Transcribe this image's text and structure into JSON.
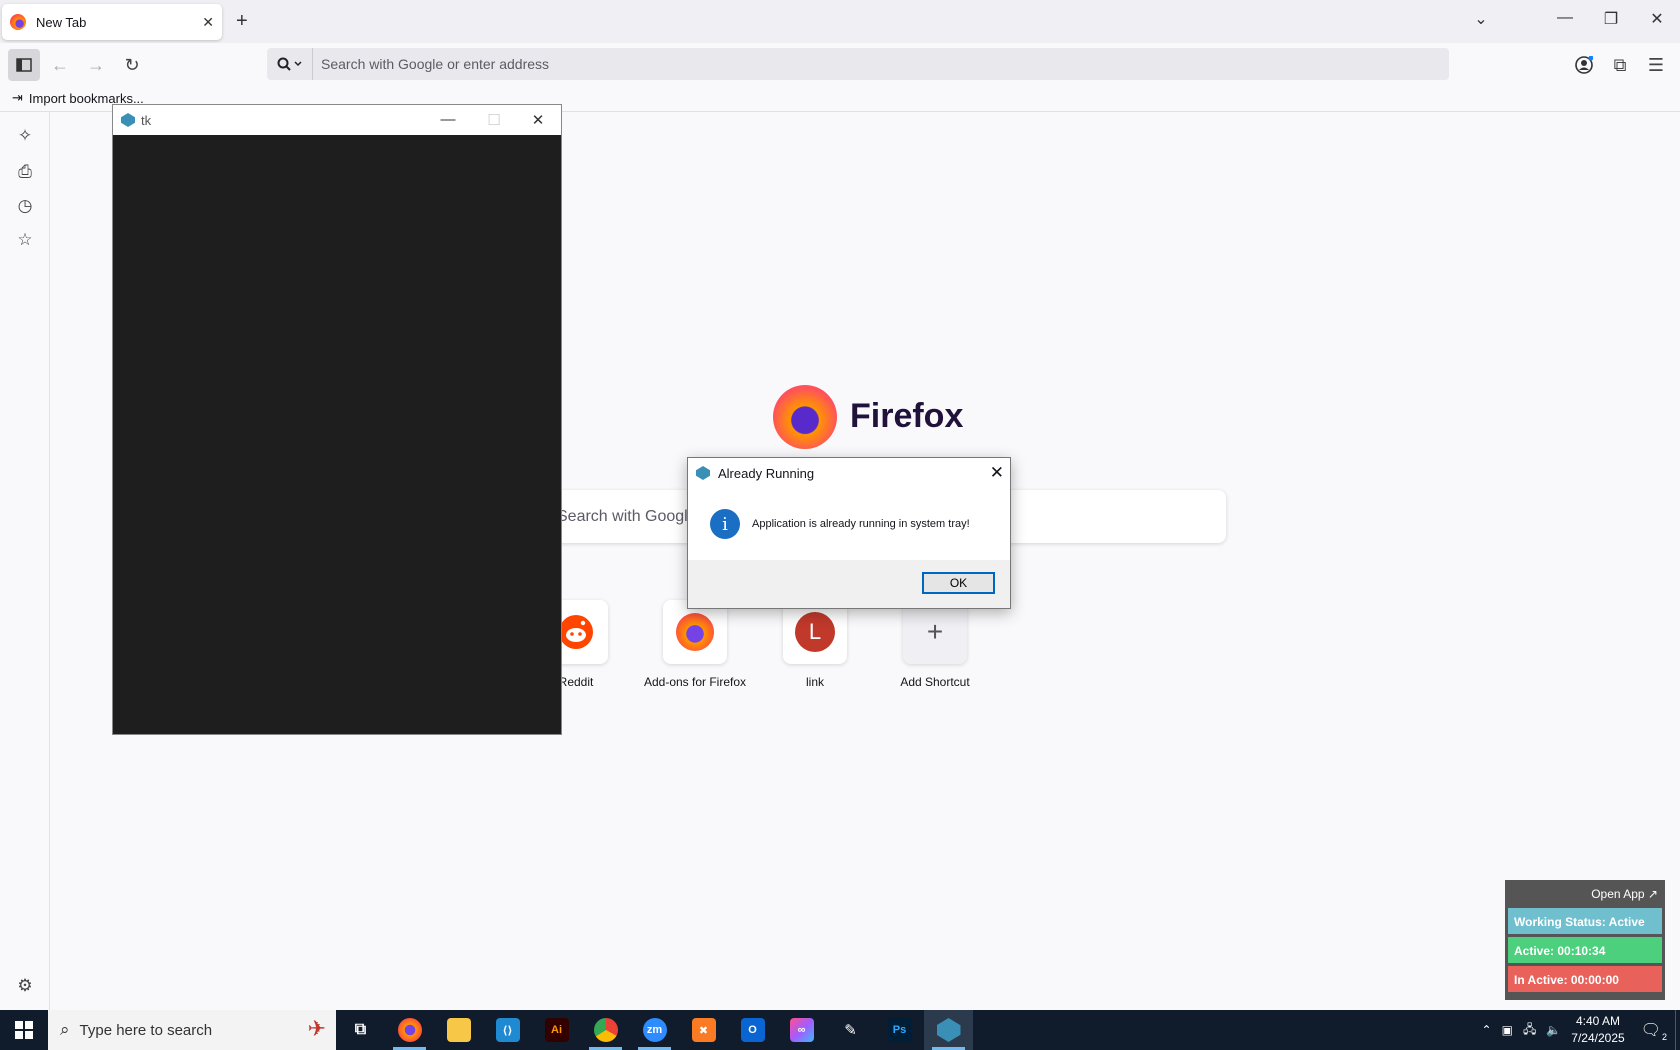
{
  "browser": {
    "tab_title": "New Tab",
    "url_placeholder": "Search with Google or enter address",
    "import_bookmarks": "Import bookmarks..."
  },
  "newtab": {
    "brand": "Firefox",
    "search_placeholder": "Search with Google",
    "shortcuts": [
      {
        "label": "Reddit"
      },
      {
        "label": "Add-ons for Firefox"
      },
      {
        "label": "link",
        "letter": "L"
      },
      {
        "label": "Add Shortcut"
      }
    ]
  },
  "tk_window": {
    "title": "tk"
  },
  "dialog": {
    "title": "Already Running",
    "message": "Application is already running in system tray!",
    "ok_label": "OK"
  },
  "tracker": {
    "open_app": "Open App ↗",
    "status": "Working Status: Active",
    "active": "Active: 00:10:34",
    "inactive": "In Active: 00:00:00",
    "colors": {
      "status": "#6fbfcf",
      "active": "#4cd07d",
      "inactive": "#e8615a"
    }
  },
  "taskbar": {
    "search_placeholder": "Type here to search",
    "time": "4:40 AM",
    "date": "7/24/2025",
    "notif_count": "2",
    "apps": [
      "task-view",
      "firefox",
      "file-explorer",
      "vscode",
      "illustrator",
      "chrome",
      "zoom",
      "xampp",
      "outlook",
      "creative-cloud",
      "pen-tool",
      "photoshop",
      "tk-app"
    ]
  }
}
